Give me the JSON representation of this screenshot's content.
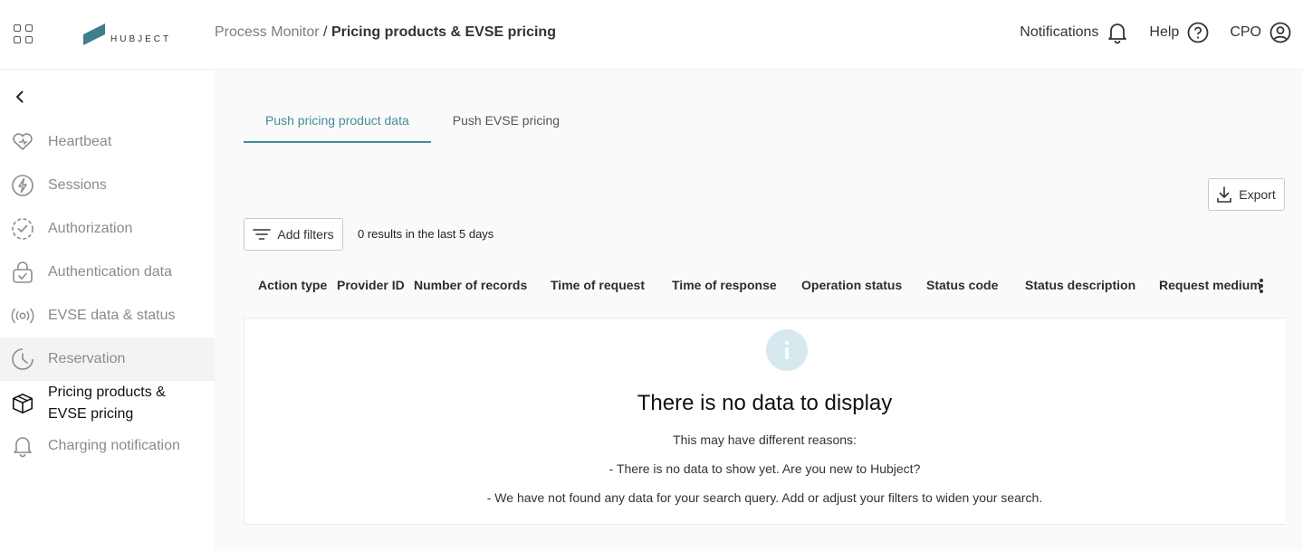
{
  "header": {
    "logo_text": "HUBJECT",
    "breadcrumb": {
      "parent": "Process Monitor",
      "separator": " / ",
      "current": "Pricing products & EVSE pricing"
    },
    "notifications_label": "Notifications",
    "help_label": "Help",
    "user_label": "CPO"
  },
  "sidebar": {
    "items": [
      {
        "label": "Heartbeat",
        "icon": "heart-icon"
      },
      {
        "label": "Sessions",
        "icon": "lightning-icon"
      },
      {
        "label": "Authorization",
        "icon": "check-circle-icon"
      },
      {
        "label": "Authentication data",
        "icon": "lock-check-icon"
      },
      {
        "label": "EVSE data & status",
        "icon": "signal-icon"
      },
      {
        "label": "Reservation",
        "icon": "clock-icon"
      },
      {
        "label": "Pricing products & EVSE pricing",
        "icon": "box-icon"
      },
      {
        "label": "Charging notification",
        "icon": "bell-icon"
      }
    ]
  },
  "main": {
    "tabs": [
      {
        "label": "Push pricing product data",
        "active": true
      },
      {
        "label": "Push EVSE pricing",
        "active": false
      }
    ],
    "export_label": "Export",
    "add_filters_label": "Add filters",
    "results_text": "0 results in the last 5 days",
    "columns": [
      "Action type",
      "Provider ID",
      "Number of records",
      "Time of request",
      "Time of response",
      "Operation status",
      "Status code",
      "Status description",
      "Request medium"
    ],
    "empty": {
      "title": "There is no data to display",
      "line1": "This may have different reasons:",
      "line2": "- There is no data to show yet. Are you new to Hubject?",
      "line3": "- We have not found any data for your search query. Add or adjust your filters to widen your search."
    }
  },
  "colors": {
    "accent": "#3f8e99",
    "logo": "#3d7f8c",
    "info": "#d7e8ee"
  }
}
